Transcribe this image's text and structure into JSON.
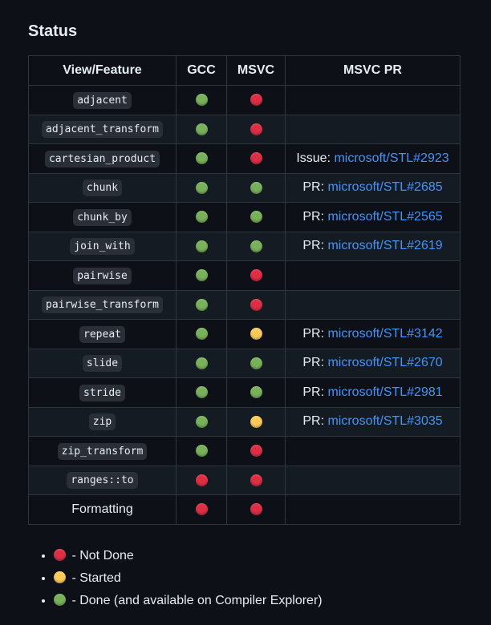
{
  "heading": "Status",
  "columns": [
    "View/Feature",
    "GCC",
    "MSVC",
    "MSVC PR"
  ],
  "rows": [
    {
      "feature": "adjacent",
      "code": true,
      "gcc": "green",
      "msvc": "red",
      "pr_prefix": "",
      "pr_link": ""
    },
    {
      "feature": "adjacent_transform",
      "code": true,
      "gcc": "green",
      "msvc": "red",
      "pr_prefix": "",
      "pr_link": ""
    },
    {
      "feature": "cartesian_product",
      "code": true,
      "gcc": "green",
      "msvc": "red",
      "pr_prefix": "Issue: ",
      "pr_link": "microsoft/STL#2923"
    },
    {
      "feature": "chunk",
      "code": true,
      "gcc": "green",
      "msvc": "green",
      "pr_prefix": "PR: ",
      "pr_link": "microsoft/STL#2685"
    },
    {
      "feature": "chunk_by",
      "code": true,
      "gcc": "green",
      "msvc": "green",
      "pr_prefix": "PR: ",
      "pr_link": "microsoft/STL#2565"
    },
    {
      "feature": "join_with",
      "code": true,
      "gcc": "green",
      "msvc": "green",
      "pr_prefix": "PR: ",
      "pr_link": "microsoft/STL#2619"
    },
    {
      "feature": "pairwise",
      "code": true,
      "gcc": "green",
      "msvc": "red",
      "pr_prefix": "",
      "pr_link": ""
    },
    {
      "feature": "pairwise_transform",
      "code": true,
      "gcc": "green",
      "msvc": "red",
      "pr_prefix": "",
      "pr_link": ""
    },
    {
      "feature": "repeat",
      "code": true,
      "gcc": "green",
      "msvc": "yellow",
      "pr_prefix": "PR: ",
      "pr_link": "microsoft/STL#3142"
    },
    {
      "feature": "slide",
      "code": true,
      "gcc": "green",
      "msvc": "green",
      "pr_prefix": "PR: ",
      "pr_link": "microsoft/STL#2670"
    },
    {
      "feature": "stride",
      "code": true,
      "gcc": "green",
      "msvc": "green",
      "pr_prefix": "PR: ",
      "pr_link": "microsoft/STL#2981"
    },
    {
      "feature": "zip",
      "code": true,
      "gcc": "green",
      "msvc": "yellow",
      "pr_prefix": "PR: ",
      "pr_link": "microsoft/STL#3035"
    },
    {
      "feature": "zip_transform",
      "code": true,
      "gcc": "green",
      "msvc": "red",
      "pr_prefix": "",
      "pr_link": ""
    },
    {
      "feature": "ranges::to",
      "code": true,
      "gcc": "red",
      "msvc": "red",
      "pr_prefix": "",
      "pr_link": ""
    },
    {
      "feature": "Formatting",
      "code": false,
      "gcc": "red",
      "msvc": "red",
      "pr_prefix": "",
      "pr_link": ""
    }
  ],
  "legend": [
    {
      "color": "red",
      "icon": "red-circle-icon",
      "text": " - Not Done"
    },
    {
      "color": "yellow",
      "icon": "yellow-circle-icon",
      "text": " - Started"
    },
    {
      "color": "green",
      "icon": "green-circle-icon",
      "text": " - Done (and available on Compiler Explorer)"
    }
  ],
  "colors": {
    "red": "#dd2e44",
    "yellow": "#fdcb58",
    "green": "#78b159",
    "link": "#4493f8",
    "background": "#0d1117"
  }
}
